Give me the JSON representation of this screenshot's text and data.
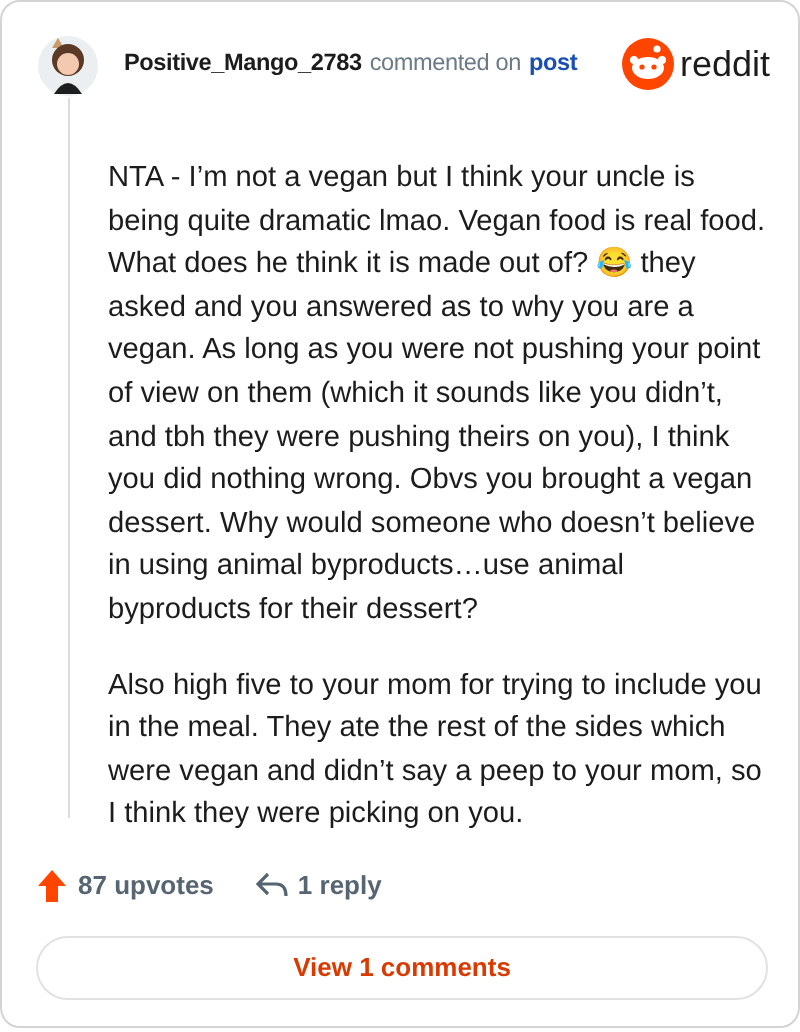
{
  "comment": {
    "author": "Positive_Mango_2783",
    "action": "commented on",
    "link": "post",
    "brand": "reddit",
    "paragraphs": [
      "NTA - I’m not a vegan but I think your uncle is being quite dramatic lmao. Vegan food is real food. What does he think it is made out of? 😂 they asked and you answered as to why you are a vegan. As long as you were not pushing your point of view on them (which it sounds like you didn’t, and tbh they were pushing theirs on you), I think you did nothing wrong. Obvs you brought a vegan dessert. Why would someone who doesn’t believe in using animal byproducts…use animal byproducts for their dessert?",
      "Also high five to your mom for trying to include you in the meal. They ate the rest of the sides which were vegan and didn’t say a peep to your mom, so I think they were picking on you."
    ],
    "upvotes": "87 upvotes",
    "replies": "1 reply",
    "view_button": "View 1 comments"
  }
}
